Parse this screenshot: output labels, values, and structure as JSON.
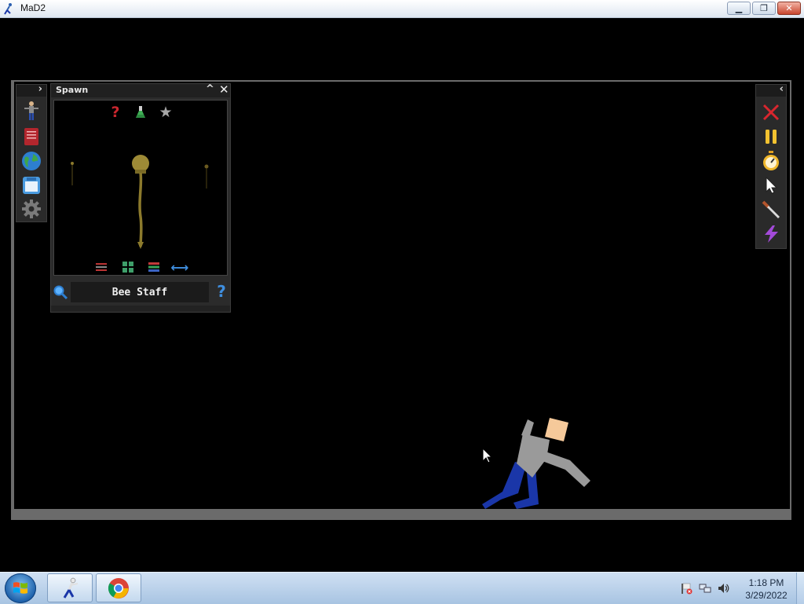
{
  "window": {
    "title": "MaD2",
    "minimize_glyph": "▁",
    "restore_glyph": "❐",
    "close_glyph": "✕"
  },
  "left_rail": {
    "toggle_glyph": "›",
    "tools": [
      "character-icon",
      "catalog-book-icon",
      "globe-icon",
      "save-disk-icon",
      "settings-gear-icon"
    ]
  },
  "spawn_panel": {
    "title": "Spawn",
    "collapse_glyph": "^",
    "close_glyph": "✕",
    "top_icons": [
      "help-icon",
      "flask-icon",
      "star-icon"
    ],
    "help_glyph": "?",
    "star_glyph": "★",
    "bottom_icons": [
      "sort-icon",
      "grid-view-icon",
      "list-view-icon",
      "swap-icon"
    ],
    "swap_glyph": "⟷",
    "selected_item": "Bee Staff",
    "search_help_glyph": "?"
  },
  "right_rail": {
    "toggle_glyph": "‹",
    "tools": [
      "delete-x-icon",
      "pause-icon",
      "stopwatch-icon",
      "cursor-pointer-icon",
      "knife-icon",
      "lightning-icon"
    ]
  },
  "taskbar": {
    "time": "1:18 PM",
    "date": "3/29/2022",
    "items": [
      "mad2-app",
      "chrome-browser"
    ]
  },
  "colors": {
    "frame": "#6b6b6b",
    "panel": "#2b2b2b",
    "staff": "#8c7a2c",
    "ragdoll_shirt": "#9a9a9a",
    "ragdoll_pants": "#1a36a8",
    "ragdoll_skin": "#f5c99a"
  }
}
